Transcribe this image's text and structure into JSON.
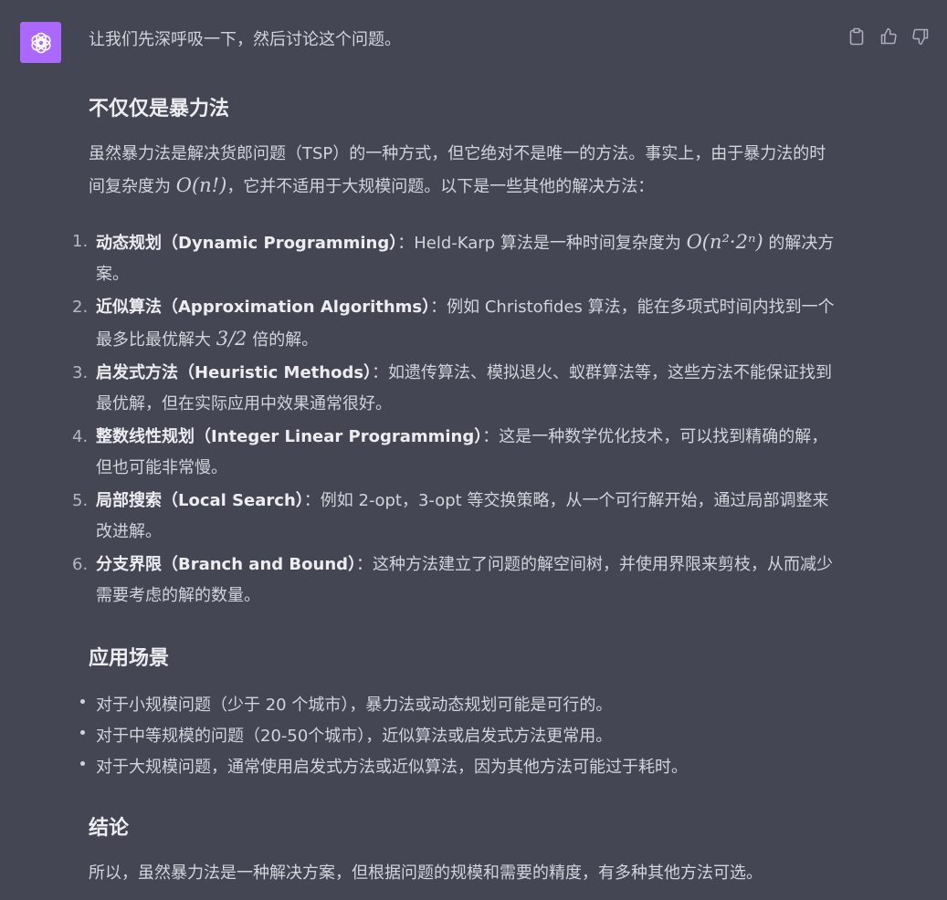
{
  "colors": {
    "background": "#444654",
    "avatar_bg": "#ab68ff",
    "text": "#d1d5db",
    "heading": "#ececf1"
  },
  "avatar": {
    "icon": "openai-logo-icon"
  },
  "actions": [
    {
      "icon": "clipboard-icon"
    },
    {
      "icon": "thumbs-up-icon"
    },
    {
      "icon": "thumbs-down-icon"
    }
  ],
  "intro": "让我们先深呼吸一下，然后讨论这个问题。",
  "section1": {
    "heading": "不仅仅是暴力法",
    "para_a": "虽然暴力法是解决货郎问题（TSP）的一种方式，但它绝对不是唯一的方法。事实上，由于暴力法的时间复杂度为 ",
    "para_math": "O(n!)",
    "para_b": "，它并不适用于大规模问题。以下是一些其他的解决方法："
  },
  "methods": [
    {
      "num": "1.",
      "title": "动态规划（Dynamic Programming）",
      "text_a": "：Held-Karp 算法是一种时间复杂度为 ",
      "math": "O(n²·2ⁿ)",
      "text_b": " 的解决方案。"
    },
    {
      "num": "2.",
      "title": "近似算法（Approximation Algorithms）",
      "text_a": "：例如 Christofides 算法，能在多项式时间内找到一个最多比最优解大 ",
      "math": "3/2",
      "text_b": " 倍的解。"
    },
    {
      "num": "3.",
      "title": "启发式方法（Heuristic Methods）",
      "text": "：如遗传算法、模拟退火、蚁群算法等，这些方法不能保证找到最优解，但在实际应用中效果通常很好。"
    },
    {
      "num": "4.",
      "title": "整数线性规划（Integer Linear Programming）",
      "text": "：这是一种数学优化技术，可以找到精确的解，但也可能非常慢。"
    },
    {
      "num": "5.",
      "title": "局部搜索（Local Search）",
      "text": "：例如 2-opt，3-opt 等交换策略，从一个可行解开始，通过局部调整来改进解。"
    },
    {
      "num": "6.",
      "title": "分支界限（Branch and Bound）",
      "text": "：这种方法建立了问题的解空间树，并使用界限来剪枝，从而减少需要考虑的解的数量。"
    }
  ],
  "section2": {
    "heading": "应用场景",
    "bullets": [
      "对于小规模问题（少于 20 个城市），暴力法或动态规划可能是可行的。",
      "对于中等规模的问题（20-50个城市），近似算法或启发式方法更常用。",
      "对于大规模问题，通常使用启发式方法或近似算法，因为其他方法可能过于耗时。"
    ]
  },
  "section3": {
    "heading": "结论",
    "para": "所以，虽然暴力法是一种解决方案，但根据问题的规模和需要的精度，有多种其他方法可选。"
  }
}
